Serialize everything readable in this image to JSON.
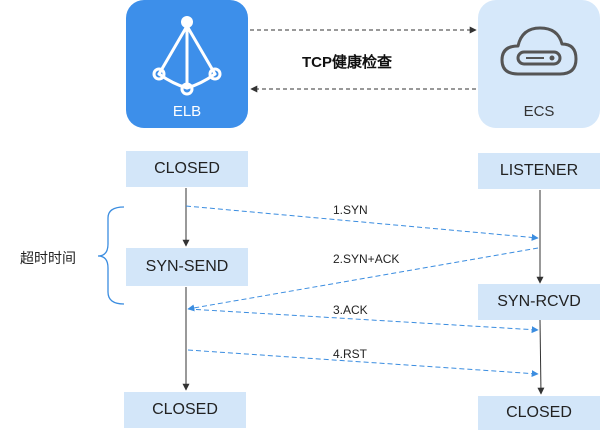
{
  "nodes": {
    "elb": {
      "label": "ELB"
    },
    "ecs": {
      "label": "ECS"
    }
  },
  "health_check": {
    "label": "TCP健康检查"
  },
  "states": {
    "elb_closed_top": "CLOSED",
    "elb_syn_send": "SYN-SEND",
    "elb_closed_bottom": "CLOSED",
    "ecs_listener": "LISTENER",
    "ecs_syn_rcvd": "SYN-RCVD",
    "ecs_closed_bottom": "CLOSED"
  },
  "messages": {
    "syn": "1.SYN",
    "syn_ack": "2.SYN+ACK",
    "ack": "3.ACK",
    "rst": "4.RST"
  },
  "timeout": {
    "label": "超时时间"
  },
  "colors": {
    "elb_tile": "#3d8fea",
    "ecs_tile": "#d6e8fa",
    "state_box": "#d3e6f9",
    "message_arrow": "#3b8de0",
    "flow_line": "#333333"
  }
}
